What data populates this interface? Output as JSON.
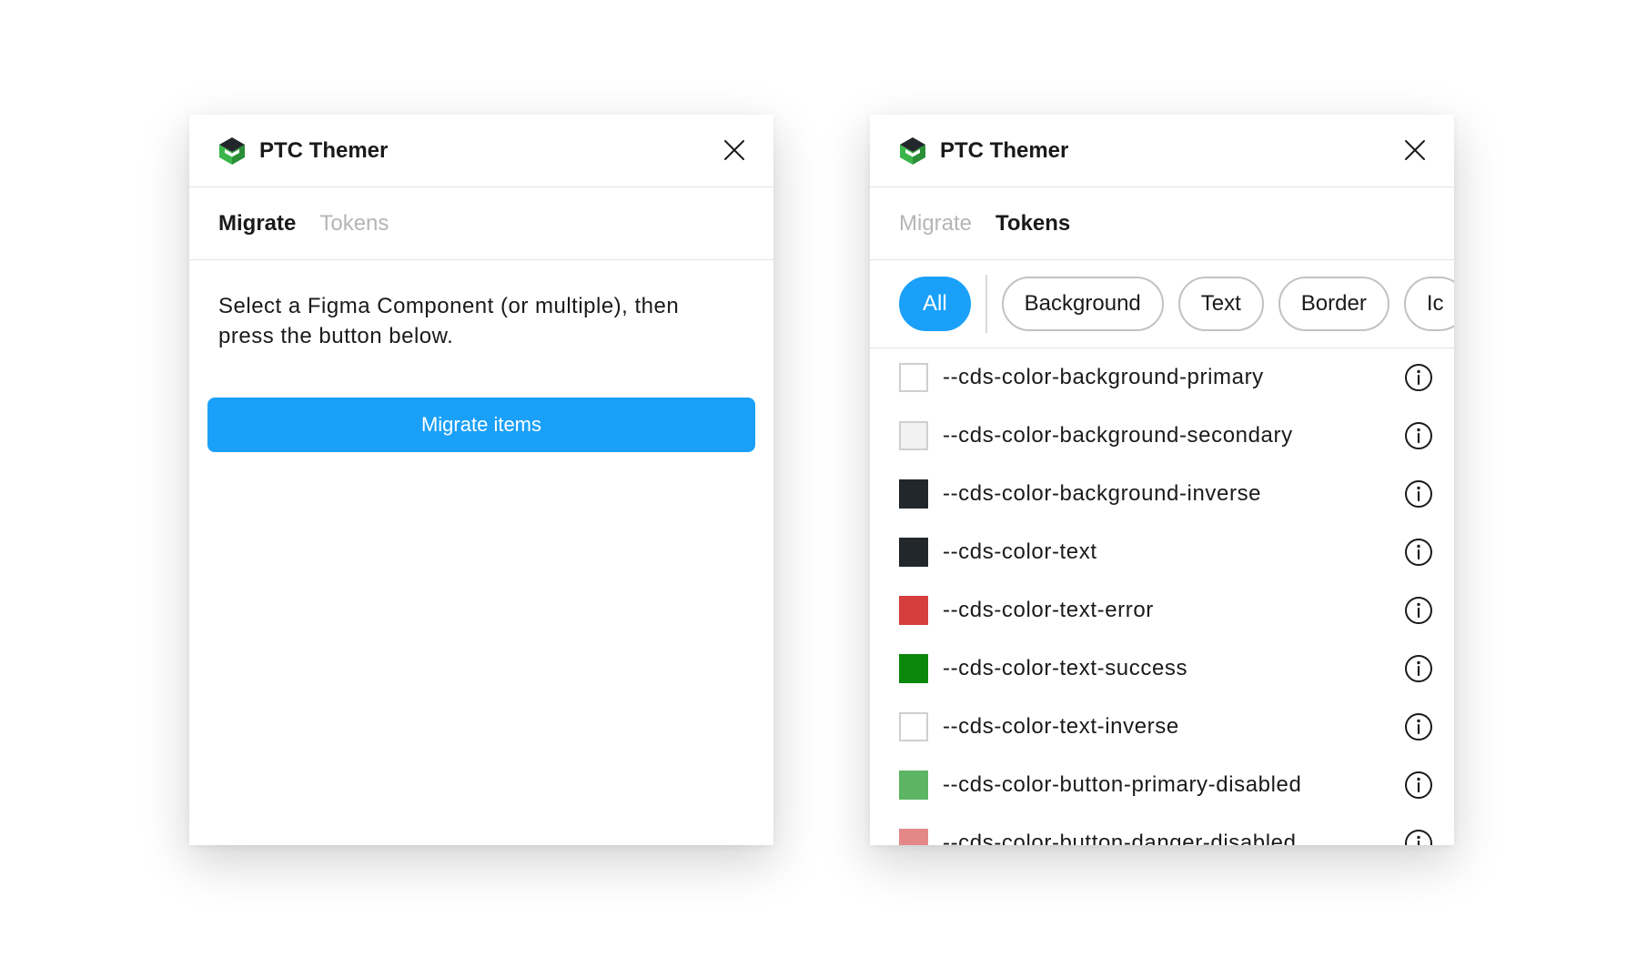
{
  "left_panel": {
    "app_title": "PTC Themer",
    "tabs": [
      {
        "label": "Migrate",
        "active": true
      },
      {
        "label": "Tokens",
        "active": false
      }
    ],
    "instructions": "Select a Figma Component (or multiple), then press the button below.",
    "migrate_button_label": "Migrate items"
  },
  "right_panel": {
    "app_title": "PTC Themer",
    "tabs": [
      {
        "label": "Migrate",
        "active": false
      },
      {
        "label": "Tokens",
        "active": true
      }
    ],
    "filters": [
      {
        "label": "All",
        "active": true
      },
      {
        "label": "Background",
        "active": false
      },
      {
        "label": "Text",
        "active": false
      },
      {
        "label": "Border",
        "active": false
      },
      {
        "label": "Ic",
        "active": false
      }
    ],
    "tokens": [
      {
        "name": "--cds-color-background-primary",
        "color": "#ffffff"
      },
      {
        "name": "--cds-color-background-secondary",
        "color": "#f2f2f2"
      },
      {
        "name": "--cds-color-background-inverse",
        "color": "#22272b"
      },
      {
        "name": "--cds-color-text",
        "color": "#22272b"
      },
      {
        "name": "--cds-color-text-error",
        "color": "#d63e3e"
      },
      {
        "name": "--cds-color-text-success",
        "color": "#0b870b"
      },
      {
        "name": "--cds-color-text-inverse",
        "color": "#ffffff"
      },
      {
        "name": "--cds-color-button-primary-disabled",
        "color": "#5cb563"
      },
      {
        "name": "--cds-color-button-danger-disabled",
        "color": "#e38787"
      }
    ]
  },
  "colors": {
    "accent": "#1aa0f8",
    "logo_dark": "#22272b",
    "logo_green": "#3ab54a"
  },
  "icons": {
    "logo": "ptc-logo-icon",
    "close": "close-icon",
    "info": "info-icon"
  }
}
